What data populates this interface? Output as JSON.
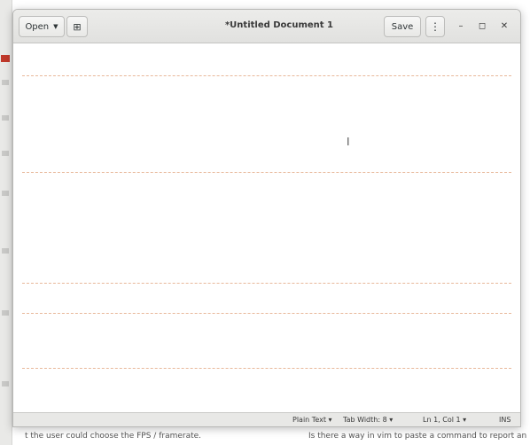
{
  "window": {
    "title": "*Untitled Document 1",
    "open_label": "Open",
    "save_label": "Save"
  },
  "statusbar": {
    "language": "Plain Text",
    "tab_width": "Tab Width: 8",
    "position": "Ln 1, Col 1",
    "mode": "INS"
  },
  "background": {
    "bottom_left_text": "t the user could choose the FPS / framerate.",
    "bottom_right_text": "Is there a way in vim to paste a command to report an error"
  },
  "icons": {
    "open_dropdown": "chevron-down-icon",
    "new_document": "new-document-icon",
    "menu": "hamburger-menu-icon",
    "minimize": "minimize-icon",
    "maximize": "maximize-icon",
    "close": "close-icon"
  },
  "colors": {
    "headerbar": "#e1e1df",
    "editor_bg": "#ffffff",
    "statusbar": "#e8e8e6"
  }
}
